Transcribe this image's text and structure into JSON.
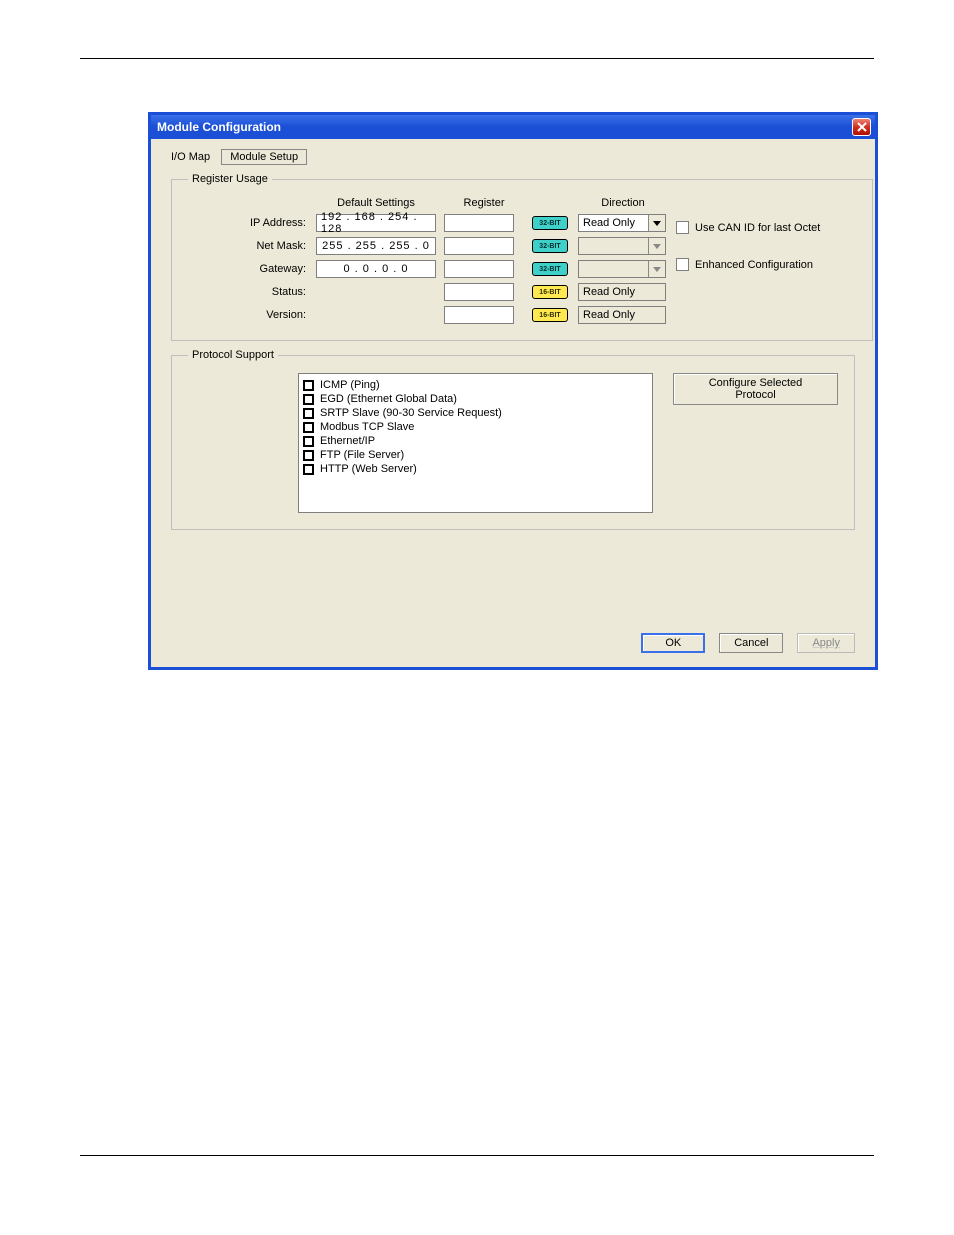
{
  "window": {
    "title": "Module Configuration"
  },
  "tabs": {
    "io_map": "I/O Map",
    "module_setup": "Module Setup"
  },
  "register_usage": {
    "legend": "Register Usage",
    "headers": {
      "default_settings": "Default Settings",
      "register": "Register",
      "direction": "Direction"
    },
    "rows": {
      "ip_address": {
        "label": "IP Address:",
        "value": "192 . 168 . 254 . 128",
        "bit": "32-BIT",
        "direction": "Read Only"
      },
      "net_mask": {
        "label": "Net Mask:",
        "value": "255 . 255 . 255 .   0",
        "bit": "32-BIT",
        "direction": ""
      },
      "gateway": {
        "label": "Gateway:",
        "value": "0  .   0  .   0  .   0",
        "bit": "32-BIT",
        "direction": ""
      },
      "status": {
        "label": "Status:",
        "value": "",
        "bit": "16-BIT",
        "direction": "Read Only"
      },
      "version": {
        "label": "Version:",
        "value": "",
        "bit": "16-BIT",
        "direction": "Read Only"
      }
    },
    "checkboxes": {
      "can_id": "Use CAN ID for last Octet",
      "enhanced": "Enhanced Configuration"
    }
  },
  "protocol_support": {
    "legend": "Protocol Support",
    "items": [
      "ICMP (Ping)",
      "EGD (Ethernet Global Data)",
      "SRTP Slave (90-30 Service Request)",
      "Modbus TCP Slave",
      "Ethernet/IP",
      "FTP (File Server)",
      "HTTP (Web Server)"
    ],
    "config_btn": "Configure Selected Protocol"
  },
  "buttons": {
    "ok": "OK",
    "cancel": "Cancel",
    "apply": "Apply"
  }
}
